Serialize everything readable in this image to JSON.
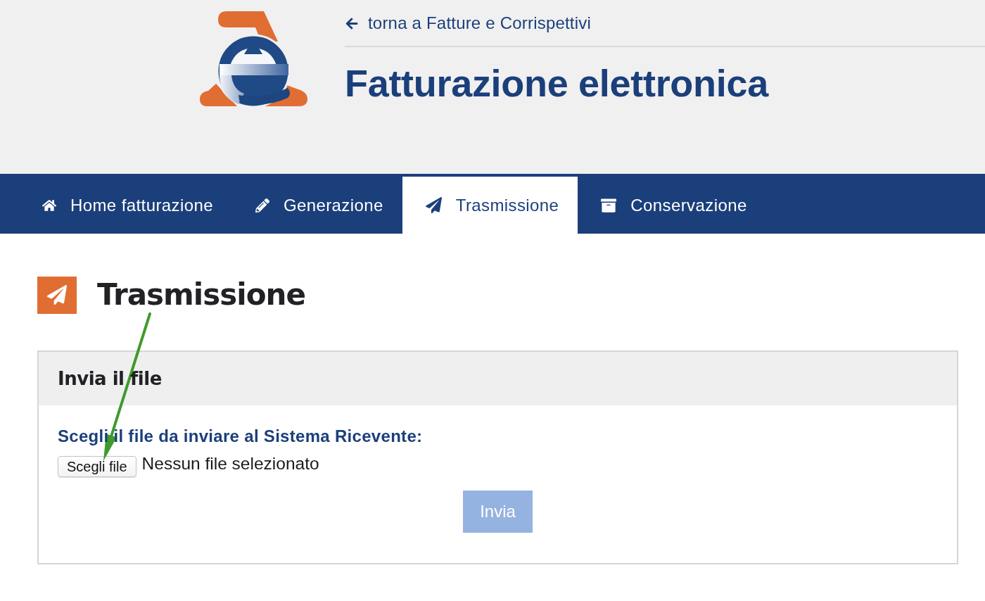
{
  "header": {
    "back_link": "torna a Fatture e Corrispettivi",
    "title": "Fatturazione elettronica"
  },
  "nav": {
    "tabs": [
      {
        "label": "Home fatturazione",
        "selected": false
      },
      {
        "label": "Generazione",
        "selected": false
      },
      {
        "label": "Trasmissione",
        "selected": true
      },
      {
        "label": "Conservazione",
        "selected": false
      }
    ]
  },
  "page": {
    "title": "Trasmissione"
  },
  "panel": {
    "title": "Invia il file",
    "label": "Scegli il file da inviare al Sistema Ricevente:",
    "file_button": "Scegli file",
    "file_status": "Nessun file selezionato",
    "submit": {
      "label": "Invia",
      "disabled": true
    }
  },
  "annotations": [
    {
      "kind": "arrow"
    }
  ]
}
